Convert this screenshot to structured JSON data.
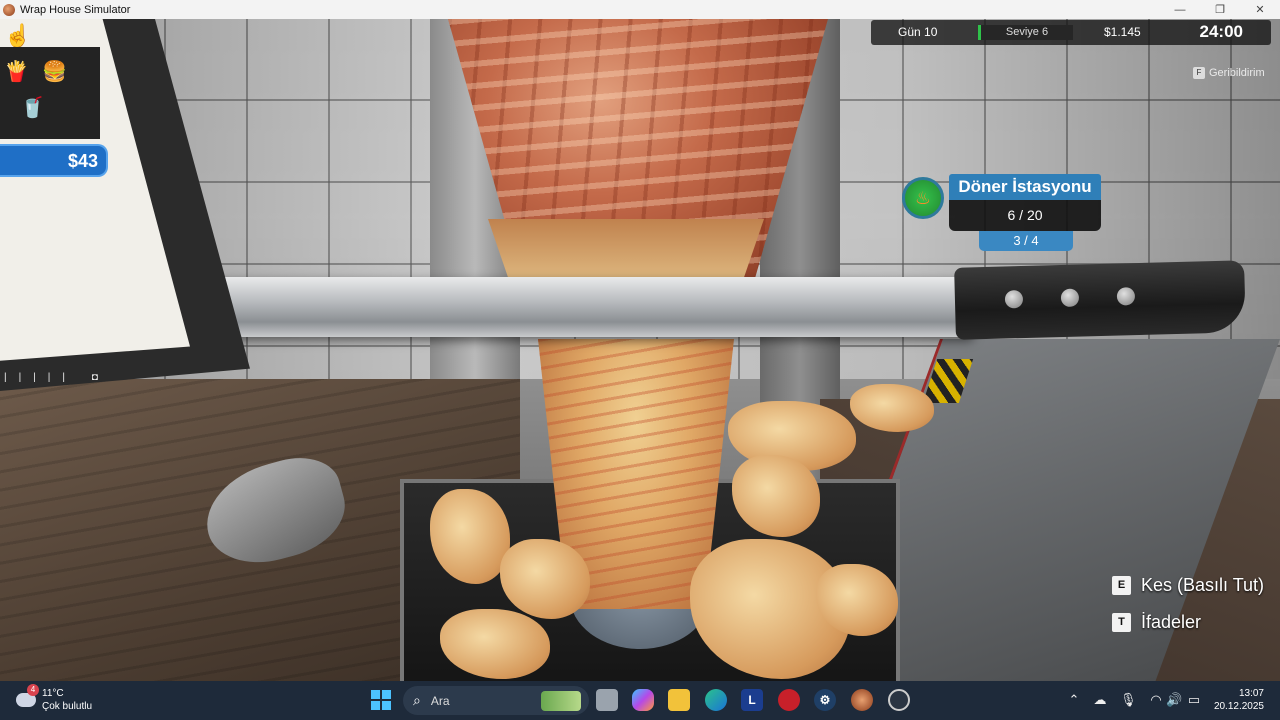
{
  "window": {
    "title": "Wrap House Simulator",
    "controls": [
      "—",
      "❐",
      "✕"
    ]
  },
  "hud": {
    "day": "Gün 10",
    "level": "Seviye 6",
    "money": "$1.145",
    "time": "24:00",
    "feedback_key": "F",
    "feedback": "Geribildirim"
  },
  "monitor": {
    "price": "$43",
    "menu_icons": [
      "fries-icon",
      "burger-icon",
      "drink-icon"
    ]
  },
  "station": {
    "title": "Döner İstasyonu",
    "count": "6 / 20",
    "sub_count": "3 / 4",
    "icon": "fire-icon"
  },
  "prompts": [
    {
      "key": "E",
      "label": "Kes (Basılı Tut)"
    },
    {
      "key": "T",
      "label": "İfadeler"
    }
  ],
  "taskbar": {
    "weather_temp": "11°C",
    "weather_desc": "Çok bulutlu",
    "weather_badge": "4",
    "search_placeholder": "Ara",
    "time": "13:07",
    "date": "20.12.2025"
  }
}
